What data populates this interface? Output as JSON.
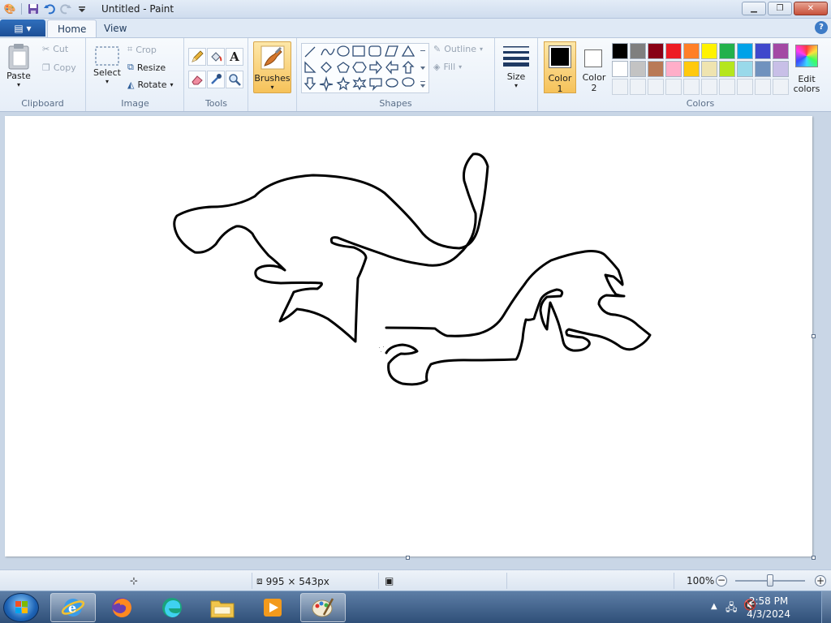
{
  "window": {
    "title": "Untitled - Paint",
    "minimize_label": "▁",
    "restore_label": "❐",
    "close_label": "✕"
  },
  "tabs": {
    "app_menu": "▤ ▾",
    "home": "Home",
    "view": "View",
    "help": "?"
  },
  "clipboard": {
    "paste": "Paste",
    "cut": "Cut",
    "copy": "Copy",
    "group": "Clipboard"
  },
  "image": {
    "select": "Select",
    "crop": "Crop",
    "resize": "Resize",
    "rotate": "Rotate",
    "group": "Image"
  },
  "tools": {
    "group": "Tools",
    "text_tool": "A"
  },
  "brushes": {
    "label": "Brushes"
  },
  "shapes": {
    "outline": "Outline",
    "fill": "Fill",
    "group": "Shapes"
  },
  "size": {
    "label": "Size"
  },
  "colors": {
    "color1_label": "Color",
    "color1_num": "1",
    "color2_label": "Color",
    "color2_num": "2",
    "edit_label": "Edit",
    "edit_label2": "colors",
    "group": "Colors",
    "color1_value": "#000000",
    "color2_value": "#ffffff",
    "palette_row1": [
      "#000000",
      "#7f7f7f",
      "#880015",
      "#ed1c24",
      "#ff7f27",
      "#fff200",
      "#22b14c",
      "#00a2e8",
      "#3f48cc",
      "#a349a4"
    ],
    "palette_row2": [
      "#ffffff",
      "#c3c3c3",
      "#b97a57",
      "#ffaec9",
      "#ffc90e",
      "#efe4b0",
      "#b5e61d",
      "#99d9ea",
      "#7092be",
      "#c8bfe7"
    ]
  },
  "status": {
    "dimensions": "995 × 543px",
    "zoom": "100%"
  },
  "taskbar": {
    "time": "2:58 PM",
    "date": "4/3/2024"
  }
}
